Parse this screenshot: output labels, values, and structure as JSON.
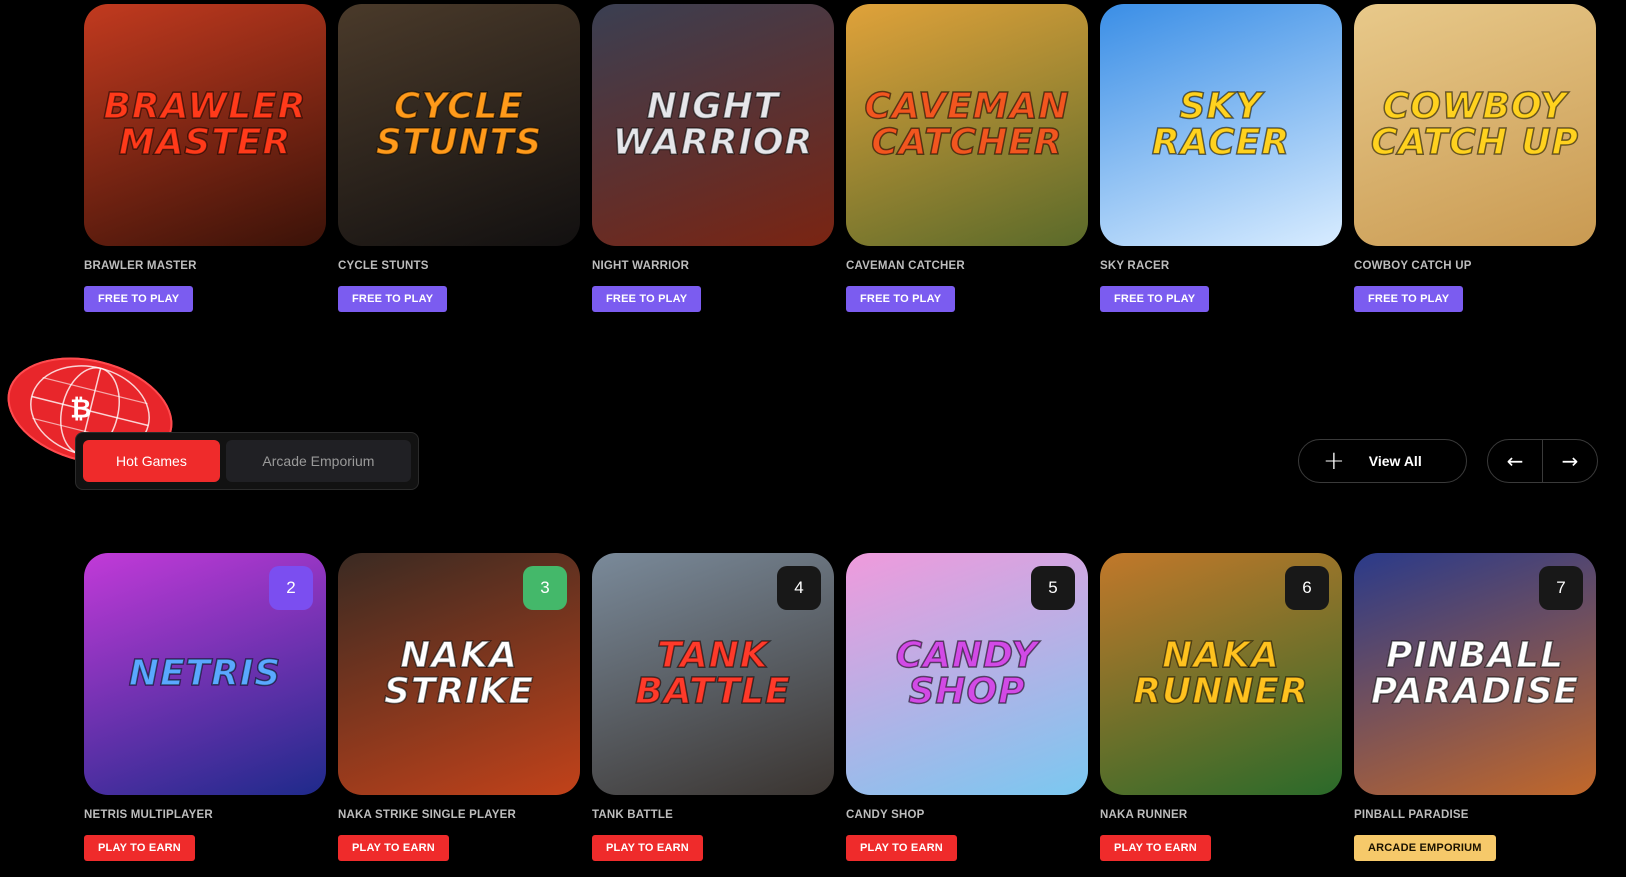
{
  "free_games": [
    {
      "title": "BRAWLER MASTER",
      "art_text": "Brawler Master",
      "badge": "FREE TO PLAY",
      "bg": "#c23a1f",
      "bg2": "#3a1208",
      "text_color": "#ff3a1a"
    },
    {
      "title": "CYCLE STUNTS",
      "art_text": "CYCLE STUNTS",
      "badge": "FREE TO PLAY",
      "bg": "#4a3a2a",
      "bg2": "#121010",
      "text_color": "#ff9a1a"
    },
    {
      "title": "NIGHT WARRIOR",
      "art_text": "NIGHT WARRIOR",
      "badge": "FREE TO PLAY",
      "bg": "#3a3f52",
      "bg2": "#7a2412",
      "text_color": "#e6e6ea"
    },
    {
      "title": "CAVEMAN CATCHER",
      "art_text": "CAVEMAN CATCHER",
      "badge": "FREE TO PLAY",
      "bg": "#e0a23a",
      "bg2": "#5a6a2a",
      "text_color": "#f2561f"
    },
    {
      "title": "SKY RACER",
      "art_text": "sky RACER",
      "badge": "FREE TO PLAY",
      "bg": "#3a8ee6",
      "bg2": "#d8ecff",
      "text_color": "#ffd21f"
    },
    {
      "title": "COWBOY CATCH UP",
      "art_text": "COWBOY CATCH UP",
      "badge": "FREE TO PLAY",
      "bg": "#e8c98a",
      "bg2": "#c99a52",
      "text_color": "#ffd21f"
    }
  ],
  "tabs": {
    "hot": "Hot Games",
    "arcade": "Arcade Emporium"
  },
  "view_all": "View All",
  "nav": {
    "prev": "←",
    "next": "→"
  },
  "globe_symbol": "₿",
  "hot_games": [
    {
      "title": "NETRIS MULTIPLAYER",
      "art_text": "NETRIS",
      "rank": "2",
      "rank_style": "purple",
      "badge": "PLAY TO EARN",
      "badge_style": "earn",
      "bg": "#c23ad8",
      "bg2": "#1e2a8a",
      "text_color": "#5aa8ff"
    },
    {
      "title": "NAKA STRIKE SINGLE PLAYER",
      "art_text": "NAKA STRIKE",
      "rank": "3",
      "rank_style": "green",
      "badge": "PLAY TO EARN",
      "badge_style": "earn",
      "bg": "#3a2a22",
      "bg2": "#c2421a",
      "text_color": "#ffffff"
    },
    {
      "title": "TANK BATTLE",
      "art_text": "TANK BATTLE",
      "rank": "4",
      "rank_style": "dark",
      "badge": "PLAY TO EARN",
      "badge_style": "earn",
      "bg": "#7a8a9a",
      "bg2": "#3a3430",
      "text_color": "#ff3a2a"
    },
    {
      "title": "CANDY SHOP",
      "art_text": "Candy Shop",
      "rank": "5",
      "rank_style": "dark",
      "badge": "PLAY TO EARN",
      "badge_style": "earn",
      "bg": "#f09adc",
      "bg2": "#7ac8f0",
      "text_color": "#d24ae6"
    },
    {
      "title": "NAKA RUNNER",
      "art_text": "NAKA RUNNER",
      "rank": "6",
      "rank_style": "dark",
      "badge": "PLAY TO EARN",
      "badge_style": "earn",
      "bg": "#c2782a",
      "bg2": "#2a6a2a",
      "text_color": "#ffc21f"
    },
    {
      "title": "PINBALL PARADISE",
      "art_text": "PINBALL PARADISE",
      "rank": "7",
      "rank_style": "dark",
      "badge": "ARCADE EMPORIUM",
      "badge_style": "arcade",
      "bg": "#2a3a8a",
      "bg2": "#c2682a",
      "text_color": "#ffffff"
    }
  ]
}
